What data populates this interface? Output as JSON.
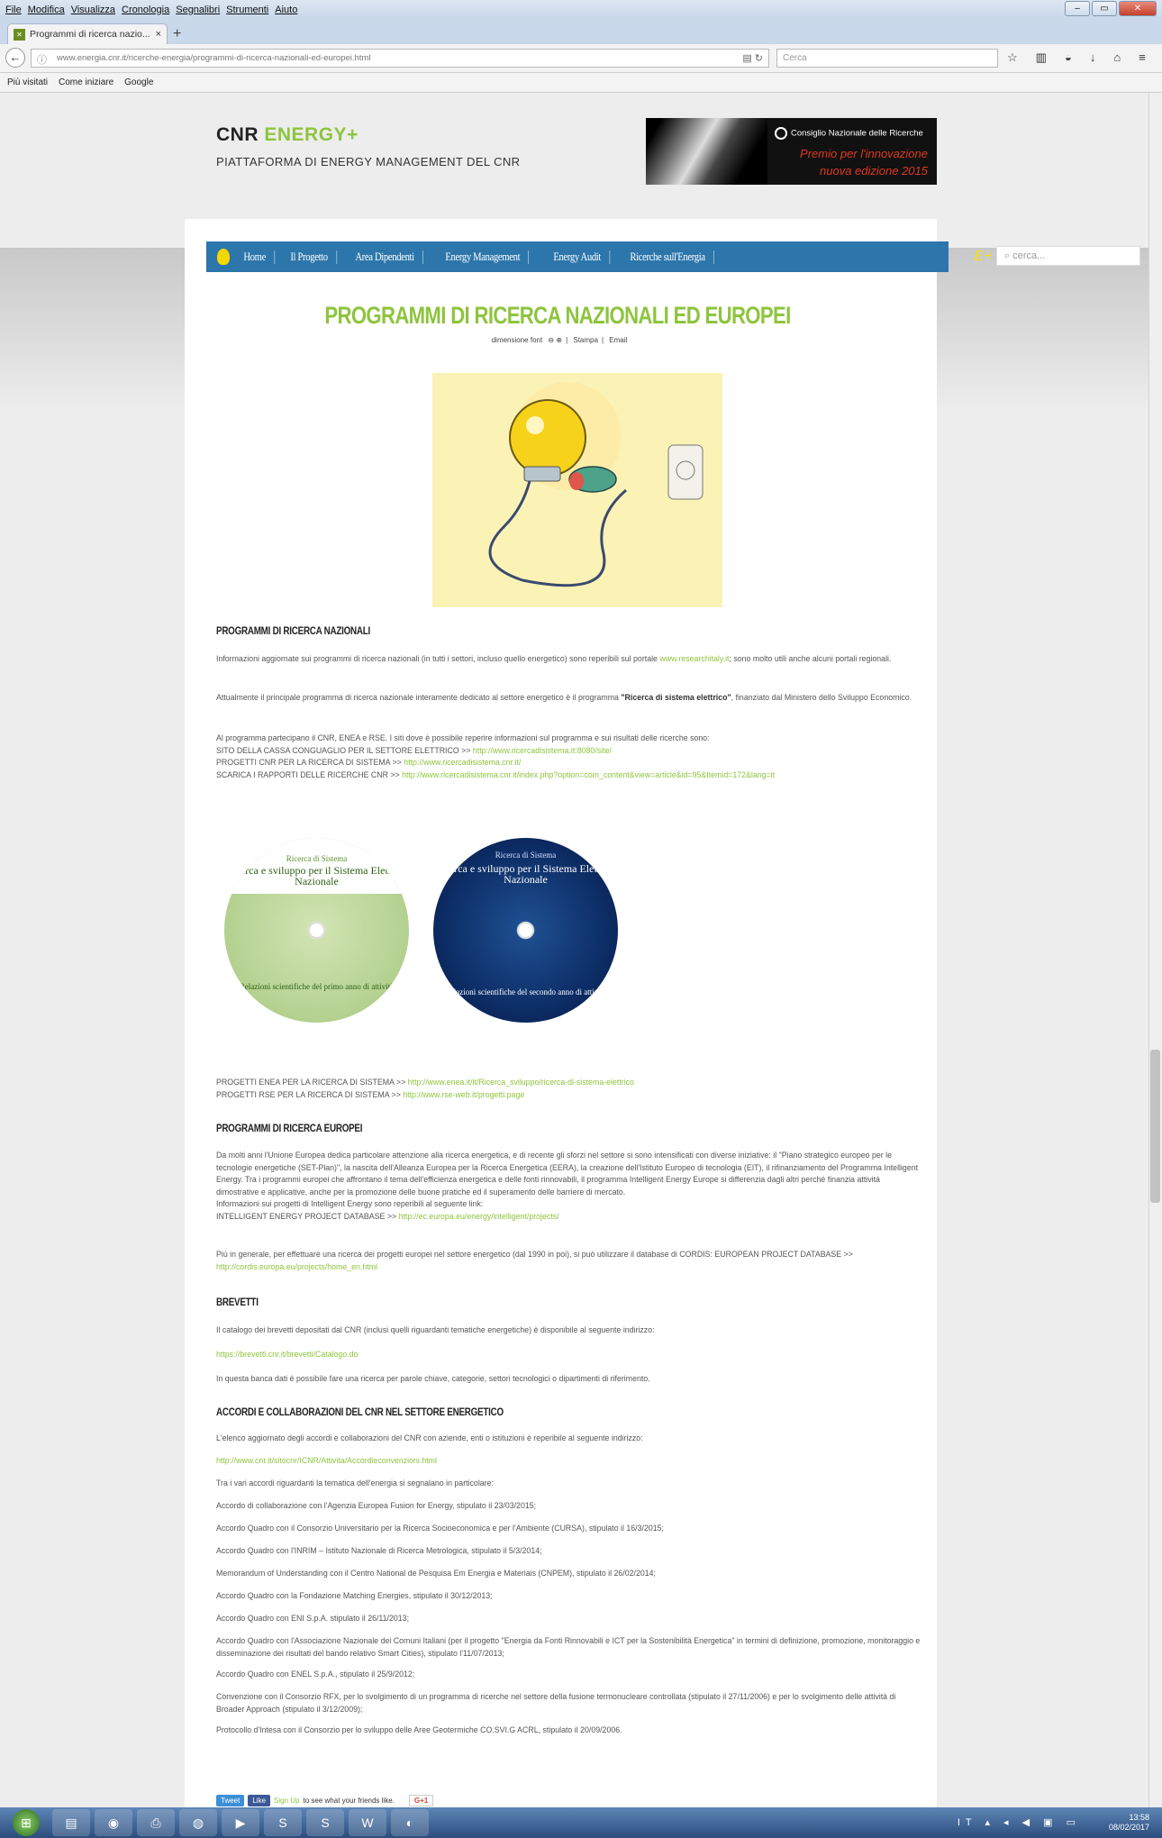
{
  "browser": {
    "menu": [
      "File",
      "Modifica",
      "Visualizza",
      "Cronologia",
      "Segnalibri",
      "Strumenti",
      "Aiuto"
    ],
    "tab_title": "Programmi di ricerca nazio...",
    "url": "www.energia.cnr.it/ricerche-energia/programmi-di-ricerca-nazionali-ed-europei.html",
    "search_placeholder": "Cerca",
    "bookmarks": [
      "Più visitati",
      "Come iniziare",
      "Google"
    ]
  },
  "site": {
    "brand_main": "CNR ",
    "brand_accent": "ENERGY+",
    "tagline": "PIATTAFORMA DI ENERGY MANAGEMENT DEL CNR",
    "banner_org": "Consiglio Nazionale delle Ricerche",
    "banner_line2": "Premio per l'innovazione",
    "banner_line3": "nuova edizione 2015",
    "nav": [
      "Home",
      "Il Progetto",
      "Area Dipendenti",
      "Energy Management",
      "Energy Audit",
      "Ricerche sull'Energia"
    ],
    "nav_logo": "E+",
    "search_placeholder": "cerca..."
  },
  "page": {
    "title": "PROGRAMMI DI RICERCA NAZIONALI ED EUROPEI",
    "tools": {
      "font": "dimensione font",
      "print": "Stampa",
      "email": "Email"
    },
    "naz": {
      "heading": "PROGRAMMI DI RICERCA NAZIONALI",
      "p1a": "Informazioni aggiornate sui programmi di ricerca nazionali (in tutti i settori, incluso quello energetico) sono reperibili sul portale ",
      "p1link": "www.researchitaly.it",
      "p1b": "; sono molto utili anche alcuni portali regionali.",
      "p2a": "Attualmente il principale programma di ricerca nazionale interamente dedicato al settore energetico è il programma ",
      "p2b": "\"Ricerca di sistema elettrico\"",
      "p2c": ", finanziato dal Ministero dello Sviluppo Economico.",
      "p3": "Al programma partecipano il CNR, ENEA e RSE. I siti dove è possibile reperire informazioni sul programma e sui risultati delle ricerche sono:",
      "l1": "SITO DELLA CASSA CONGUAGLIO PER IL SETTORE ELETTRICO >> ",
      "l1url": "http://www.ricercadisistema.it:8080/site/",
      "l2": "PROGETTI CNR PER LA RICERCA DI SISTEMA >> ",
      "l2url": "http://www.ricercadisistema.cnr.it/",
      "l3": "SCARICA I RAPPORTI DELLE RICERCHE CNR >> ",
      "l3url": "http://www.ricercadisistema.cnr.it/index.php?option=com_content&view=article&id=95&Itemid=172&lang=it",
      "l4": "PROGETTI ENEA PER LA RICERCA DI SISTEMA >> ",
      "l4url": "http://www.enea.it/it/Ricerca_sviluppo/ricerca-di-sistema-elettrico",
      "l5": "PROGETTI RSE PER LA RICERCA DI SISTEMA >> ",
      "l5url": "http://www.rse-web.it/progetti.page"
    },
    "disc1": {
      "t1": "Ricerca di Sistema",
      "t2": "Ricerca e sviluppo per il Sistema Elettrico Nazionale",
      "t3": "Relazioni scientifiche del primo anno di attività"
    },
    "disc2": {
      "t1": "Ricerca di Sistema",
      "t2": "Ricerca e sviluppo per il Sistema Elettrico Nazionale",
      "t3": "Relazioni scientifiche del secondo anno di attività"
    },
    "eur": {
      "heading": "PROGRAMMI DI RICERCA EUROPEI",
      "p1": "Da molti anni l'Unione Europea dedica particolare attenzione alla ricerca energetica, e di recente gli sforzi nel settore si sono intensificati con diverse iniziative: il \"Piano strategico europeo per le tecnologie energetiche (SET-Plan)\", la nascita dell'Alleanza Europea per la Ricerca Energetica (EERA), la creazione dell'Istituto Europeo di tecnologia (EIT), il rifinanziamento del Programma Intelligent Energy. Tra i programmi europei che affrontano il tema dell'efficienza energetica e delle fonti rinnovabili, il programma Intelligent Energy Europe si differenzia dagli altri perché finanzia attività dimostrative e applicative, anche per la promozione delle buone pratiche ed il superamento delle barriere di mercato.",
      "p2": "Informazioni sui progetti di Intelligent Energy sono reperibili al seguente link:",
      "p3": "INTELLIGENT ENERGY PROJECT DATABASE >> ",
      "p3url": "http://ec.europa.eu/energy/intelligent/projects/",
      "p4": "Più in generale, per effettuare una ricerca dei progetti europei nel settore energetico (dal 1990 in poi), si può utilizzare il database di CORDIS: EUROPEAN PROJECT DATABASE >> ",
      "p4url": "http://cordis.europa.eu/projects/home_en.html"
    },
    "brev": {
      "heading": "BREVETTI",
      "p1": "Il catalogo dei brevetti depositati dal CNR (inclusi quelli riguardanti tematiche energetiche) è disponibile al seguente indirizzo:",
      "url": "https://brevetti.cnr.it/brevetti/Catalogo.do",
      "p2": "In questa banca dati è possibile fare una ricerca per parole chiave, categorie, settori tecnologici o dipartimenti di riferimento."
    },
    "acc": {
      "heading": "ACCORDI E COLLABORAZIONI DEL CNR NEL SETTORE ENERGETICO",
      "p1": "L'elenco aggiornato degli accordi e collaborazioni del CNR con aziende, enti o istituzioni è reperibile al seguente indirizzo:",
      "url": "http://www.cnr.it/sitocnr/ICNR/Attivita/Accordieconvenzioni.html",
      "p2": "Tra i vari accordi riguardanti la tematica dell'energia si segnalano in particolare:",
      "items": [
        "Accordo di collaborazione con l'Agenzia Europea Fusion for Energy, stipulato il 23/03/2015;",
        "Accordo Quadro con il Consorzio Universitario per la Ricerca Socioeconomica e per l'Ambiente (CURSA), stipulato il 16/3/2015;",
        "Accordo Quadro con l'INRIM – Istituto Nazionale di Ricerca Metrologica, stipulato il 5/3/2014;",
        "Memorandum of Understanding con il Centro National de Pesquisa Em Energia e Materiais (CNPEM), stipulato il 26/02/2014;",
        "Accordo Quadro con la Fondazione Matching Energies, stipulato il 30/12/2013;",
        "Accordo Quadro con ENI S.p.A. stipulato il 26/11/2013;",
        "Accordo Quadro con l'Associazione Nazionale dei Comuni Italiani (per il progetto \"Energia da Fonti Rinnovabili e ICT per la Sostenibilità Energetica\" in termini di definizione, promozione, monitoraggio e disseminazione dei risultati del bando relativo Smart Cities), stipulato l'11/07/2013;",
        "Accordo Quadro con ENEL S.p.A., stipulato il 25/9/2012;",
        "Convenzione con il Consorzio RFX, per lo svolgimento di un programma di ricerche nel settore della fusione termonucleare controllata (stipulato il 27/11/2006) e per lo svolgimento delle attività di Broader Approach (stipulato il 3/12/2009);",
        "Protocollo d'Intesa con il Consorzio per lo sviluppo delle Aree Geotermiche CO.SVI.G ACRL, stipulato il 20/09/2006."
      ]
    },
    "social": {
      "tweet": "Tweet",
      "like": "Like",
      "signup": "Sign Up",
      "signup_rest": " to see what your friends like.",
      "gplus": "G+1"
    }
  },
  "taskbar": {
    "lang": "IT",
    "time": "13:58",
    "date": "08/02/2017"
  }
}
